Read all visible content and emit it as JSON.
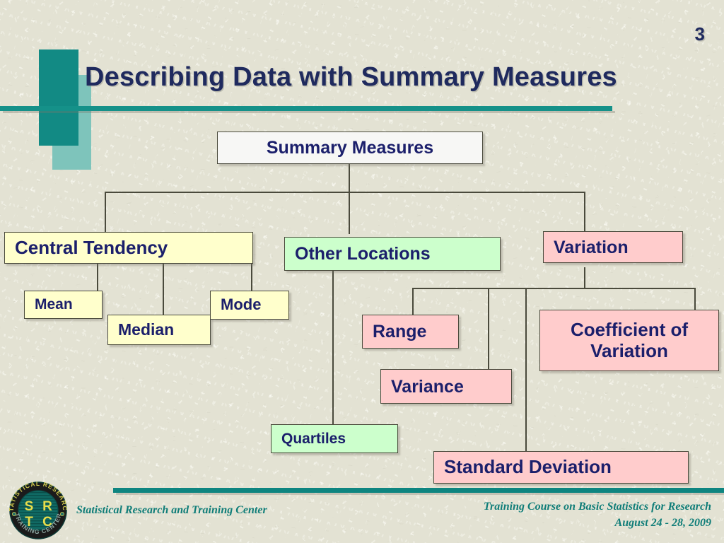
{
  "slide": {
    "page_number": "3",
    "title": "Describing Data with Summary Measures",
    "background_color": "#e3e2d3",
    "accent_color": "#128a84",
    "text_color": "#1b1f6b"
  },
  "diagram": {
    "root": {
      "label": "Summary Measures",
      "color": "#f7f7f5"
    },
    "branches": [
      {
        "label": "Central Tendency",
        "color": "#ffffcc",
        "children": [
          {
            "label": "Mean",
            "color": "#ffffcc"
          },
          {
            "label": "Median",
            "color": "#ffffcc"
          },
          {
            "label": "Mode",
            "color": "#ffffcc"
          }
        ]
      },
      {
        "label": "Other Locations",
        "color": "#ccffcc",
        "children": [
          {
            "label": "Quartiles",
            "color": "#ccffcc"
          }
        ]
      },
      {
        "label": "Variation",
        "color": "#ffcccc",
        "children": [
          {
            "label": "Range",
            "color": "#ffcccc"
          },
          {
            "label": "Variance",
            "color": "#ffcccc"
          },
          {
            "label": "Standard Deviation",
            "color": "#ffcccc"
          },
          {
            "label": "Coefficient of Variation",
            "color": "#ffcccc"
          }
        ]
      }
    ],
    "labels": {
      "root": "Summary Measures",
      "central_tendency": "Central Tendency",
      "mean": "Mean",
      "median": "Median",
      "mode": "Mode",
      "other_locations": "Other Locations",
      "quartiles": "Quartiles",
      "variation": "Variation",
      "range": "Range",
      "variance": "Variance",
      "standard_deviation": "Standard Deviation",
      "coefficient_of_variation_line1": "Coefficient of",
      "coefficient_of_variation_line2": "Variation"
    }
  },
  "footer": {
    "organization": "Statistical Research and Training Center",
    "course": "Training Course on Basic Statistics for Research",
    "dates": "August  24 - 28, 2009",
    "logo": {
      "name": "srtc-seal-logo",
      "top_arc_text": "STATISTICAL RESEARCH",
      "bottom_arc_text": "TRAINING CENTER",
      "initials_top": "S R",
      "initials_bottom": "T C",
      "letters": [
        "S",
        "R",
        "T",
        "C"
      ],
      "ring_color": "#1b1b1b",
      "disc_color": "#106a64",
      "letter_color": "#e9dd4a"
    }
  }
}
